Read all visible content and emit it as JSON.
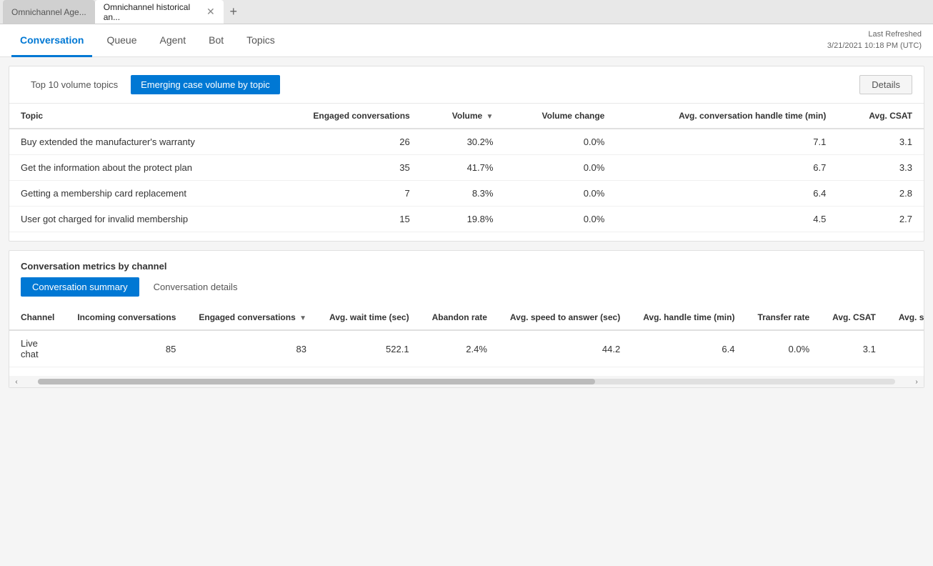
{
  "browserTabs": [
    {
      "id": "tab1",
      "label": "Omnichannel Age...",
      "active": false,
      "closable": false
    },
    {
      "id": "tab2",
      "label": "Omnichannel historical an...",
      "active": true,
      "closable": true
    }
  ],
  "newTabLabel": "+",
  "navTabs": [
    {
      "id": "conversation",
      "label": "Conversation",
      "active": true
    },
    {
      "id": "queue",
      "label": "Queue",
      "active": false
    },
    {
      "id": "agent",
      "label": "Agent",
      "active": false
    },
    {
      "id": "bot",
      "label": "Bot",
      "active": false
    },
    {
      "id": "topics",
      "label": "Topics",
      "active": false
    }
  ],
  "lastRefreshed": {
    "label": "Last Refreshed",
    "value": "3/21/2021 10:18 PM (UTC)"
  },
  "topPanel": {
    "tabs": [
      {
        "id": "top10",
        "label": "Top 10 volume topics",
        "active": false
      },
      {
        "id": "emerging",
        "label": "Emerging case volume by topic",
        "active": true
      }
    ],
    "detailsBtn": "Details",
    "tableHeaders": [
      {
        "id": "topic",
        "label": "Topic",
        "align": "left"
      },
      {
        "id": "engaged",
        "label": "Engaged conversations",
        "align": "right"
      },
      {
        "id": "volume",
        "label": "Volume",
        "align": "right",
        "sort": true
      },
      {
        "id": "volumechange",
        "label": "Volume change",
        "align": "right"
      },
      {
        "id": "avghandle",
        "label": "Avg. conversation handle time (min)",
        "align": "right"
      },
      {
        "id": "avgcsat",
        "label": "Avg. CSAT",
        "align": "right"
      }
    ],
    "rows": [
      {
        "topic": "Buy extended the manufacturer's warranty",
        "engaged": "26",
        "volume": "30.2%",
        "volumeChange": "0.0%",
        "avgHandle": "7.1",
        "avgCsat": "3.1"
      },
      {
        "topic": "Get the information about the protect plan",
        "engaged": "35",
        "volume": "41.7%",
        "volumeChange": "0.0%",
        "avgHandle": "6.7",
        "avgCsat": "3.3"
      },
      {
        "topic": "Getting a membership card replacement",
        "engaged": "7",
        "volume": "8.3%",
        "volumeChange": "0.0%",
        "avgHandle": "6.4",
        "avgCsat": "2.8"
      },
      {
        "topic": "User got charged for invalid membership",
        "engaged": "15",
        "volume": "19.8%",
        "volumeChange": "0.0%",
        "avgHandle": "4.5",
        "avgCsat": "2.7"
      }
    ]
  },
  "bottomPanel": {
    "sectionTitle": "Conversation metrics by channel",
    "subTabs": [
      {
        "id": "summary",
        "label": "Conversation summary",
        "active": true
      },
      {
        "id": "details",
        "label": "Conversation details",
        "active": false
      }
    ],
    "tableHeaders": [
      {
        "id": "channel",
        "label": "Channel",
        "align": "left"
      },
      {
        "id": "incoming",
        "label": "Incoming conversations",
        "align": "right"
      },
      {
        "id": "engaged",
        "label": "Engaged conversations",
        "align": "right",
        "sort": true
      },
      {
        "id": "avgwait",
        "label": "Avg. wait time (sec)",
        "align": "right"
      },
      {
        "id": "abandon",
        "label": "Abandon rate",
        "align": "right"
      },
      {
        "id": "avgspeeed",
        "label": "Avg. speed to answer (sec)",
        "align": "right"
      },
      {
        "id": "avghandle",
        "label": "Avg. handle time (min)",
        "align": "right"
      },
      {
        "id": "transfer",
        "label": "Transfer rate",
        "align": "right"
      },
      {
        "id": "avgcsat",
        "label": "Avg. CSAT",
        "align": "right"
      },
      {
        "id": "avgsurvey",
        "label": "Avg. survey se",
        "align": "right"
      }
    ],
    "rows": [
      {
        "channel": "Live chat",
        "incoming": "85",
        "engaged": "83",
        "avgWait": "522.1",
        "abandon": "2.4%",
        "avgSpeed": "44.2",
        "avgHandle": "6.4",
        "transfer": "0.0%",
        "avgCsat": "3.1",
        "avgSurvey": ""
      }
    ]
  }
}
